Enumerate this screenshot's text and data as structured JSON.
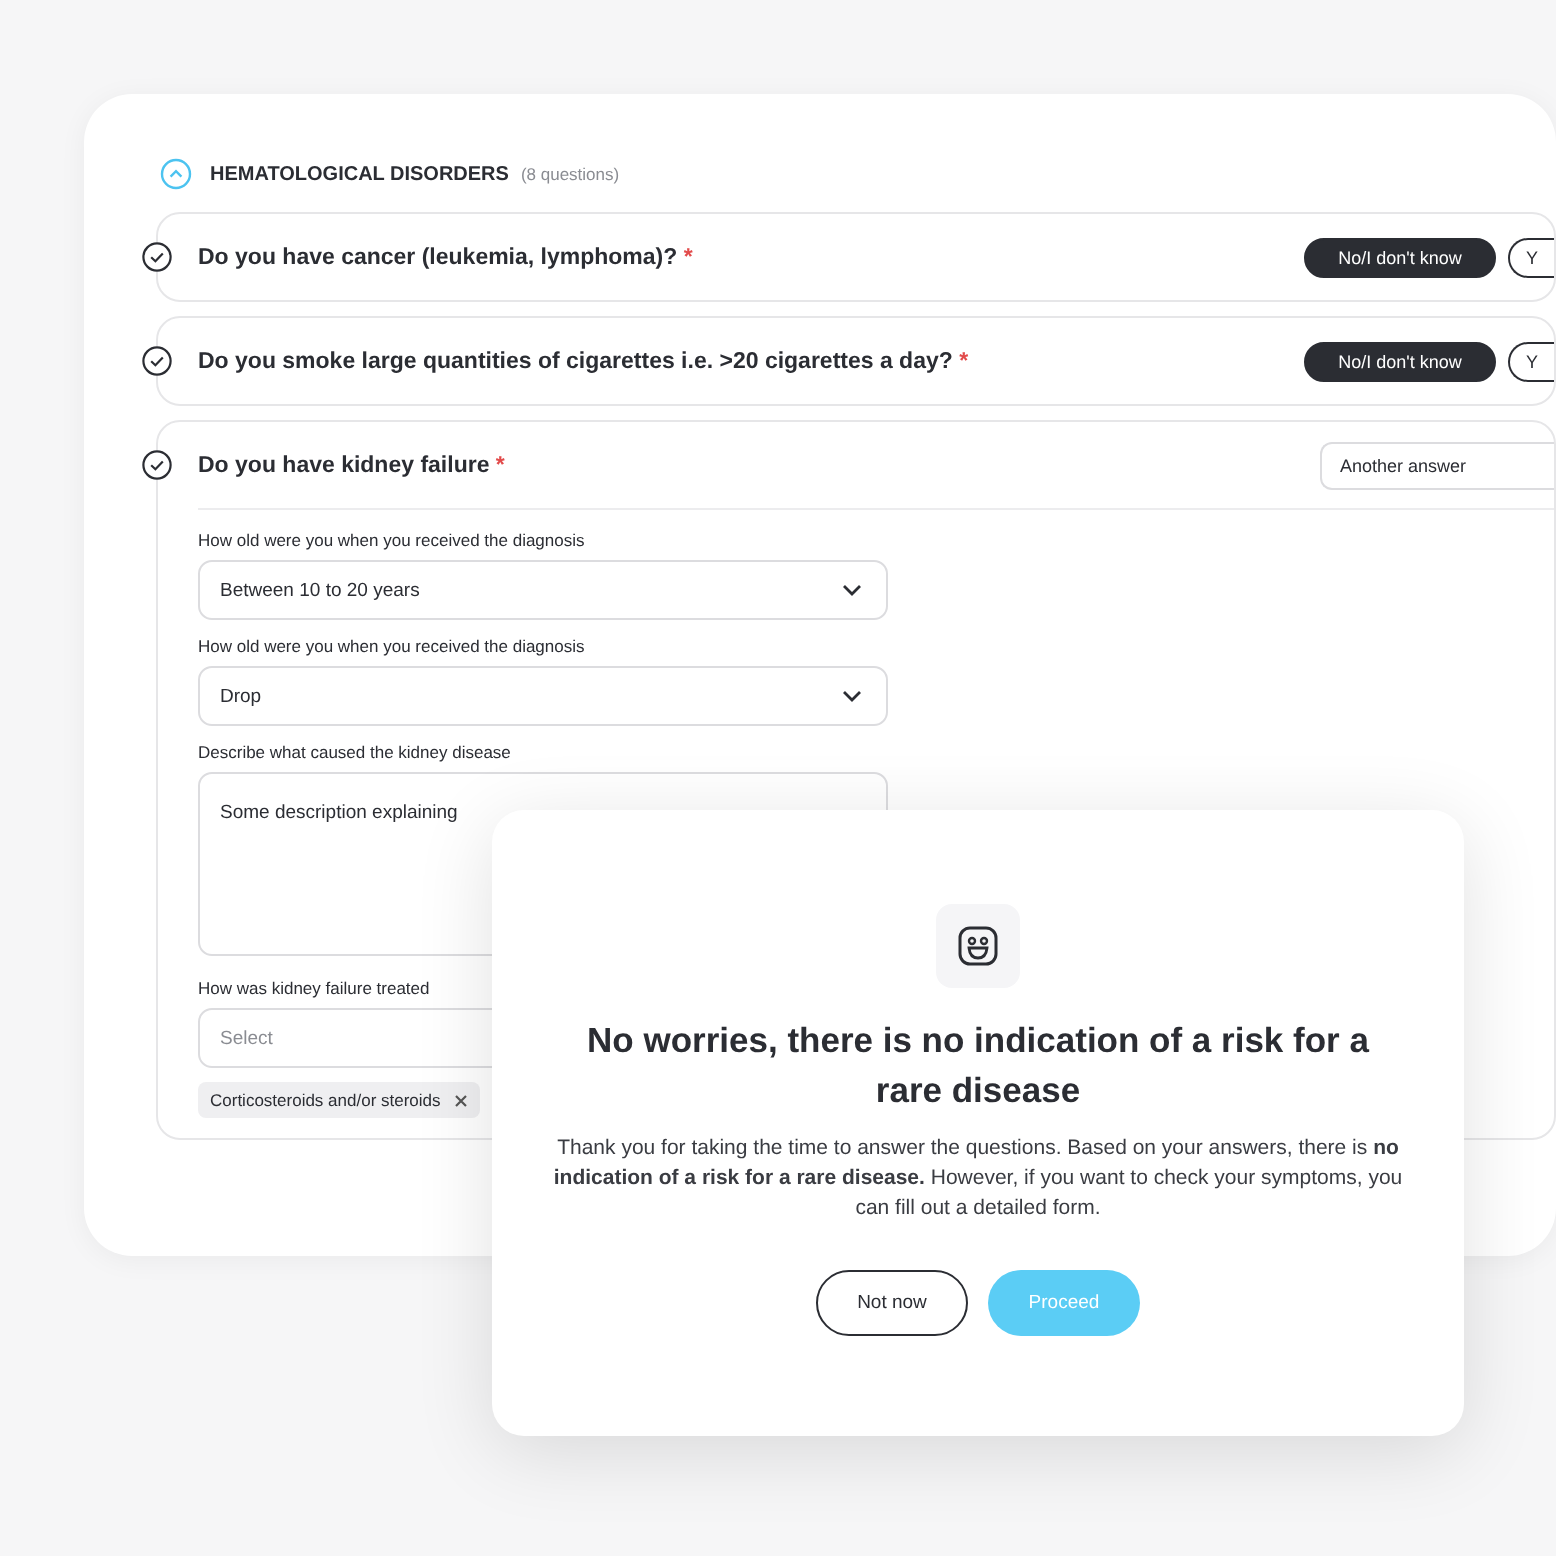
{
  "section": {
    "title": "HEMATOLOGICAL DISORDERS",
    "count": "(8 questions)",
    "expanded": true
  },
  "questions": [
    {
      "kind": "choice",
      "text": "Do you have cancer (leukemia, lymphoma)?",
      "required_mark": "*",
      "answers": [
        {
          "label": "No/I don't know",
          "selected": true
        },
        {
          "label": "Y",
          "selected": false
        }
      ]
    },
    {
      "kind": "choice",
      "text": "Do you smoke large quantities of cigarettes i.e. >20 cigarettes a day?",
      "required_mark": "*",
      "answers": [
        {
          "label": "No/I don't know",
          "selected": true
        },
        {
          "label": "Y",
          "selected": false
        }
      ]
    },
    {
      "kind": "dropdown",
      "text": "Do you have kidney failure",
      "required_mark": "*",
      "answer": "Another answer",
      "fields": [
        {
          "kind": "select",
          "label": "How old were you when you received the diagnosis",
          "value": "Between 10 to 20 years",
          "chevron": true
        },
        {
          "kind": "select",
          "label": "How old were you when you received the diagnosis",
          "value": "Drop",
          "chevron": true
        },
        {
          "kind": "textarea",
          "label": "Describe what caused the kidney disease",
          "value": "Some description explaining"
        },
        {
          "kind": "select",
          "label": "How was kidney failure treated",
          "placeholder": "Select",
          "chips": [
            "Corticosteroids and/or steroids"
          ]
        }
      ]
    }
  ],
  "dialog": {
    "title": "No worries, there is no indication of a risk for a rare disease",
    "message": "Thank you for taking the time to answer the questions. Based on your answers, there is **no indication of a risk for a rare disease.** However, if you want to check your symptoms, you can fill out a detailed form.",
    "buttons": [
      {
        "kind": "secondary",
        "label": "Not now"
      },
      {
        "kind": "primary",
        "label": "Proceed"
      }
    ]
  }
}
